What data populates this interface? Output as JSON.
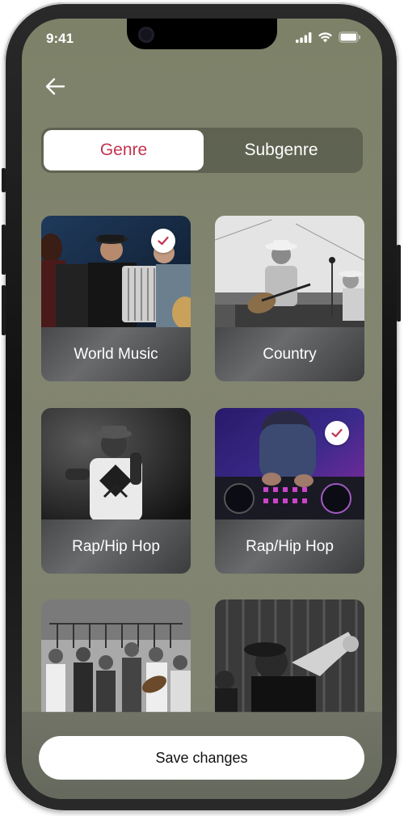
{
  "status_bar": {
    "time": "9:41"
  },
  "segmented_control": {
    "active_label": "Genre",
    "inactive_label": "Subgenre"
  },
  "cards": [
    {
      "label": "World Music",
      "selected": true
    },
    {
      "label": "Country",
      "selected": false
    },
    {
      "label": "Rap/Hip Hop",
      "selected": false
    },
    {
      "label": "Rap/Hip Hop",
      "selected": true
    },
    {
      "label": "",
      "selected": false
    },
    {
      "label": "",
      "selected": false
    }
  ],
  "save_button": {
    "label": "Save changes"
  },
  "colors": {
    "accent": "#c2344f",
    "background": "#7f836c"
  },
  "icons": [
    "back-arrow-icon",
    "signal-icon",
    "wifi-icon",
    "battery-icon",
    "checkmark-icon"
  ]
}
